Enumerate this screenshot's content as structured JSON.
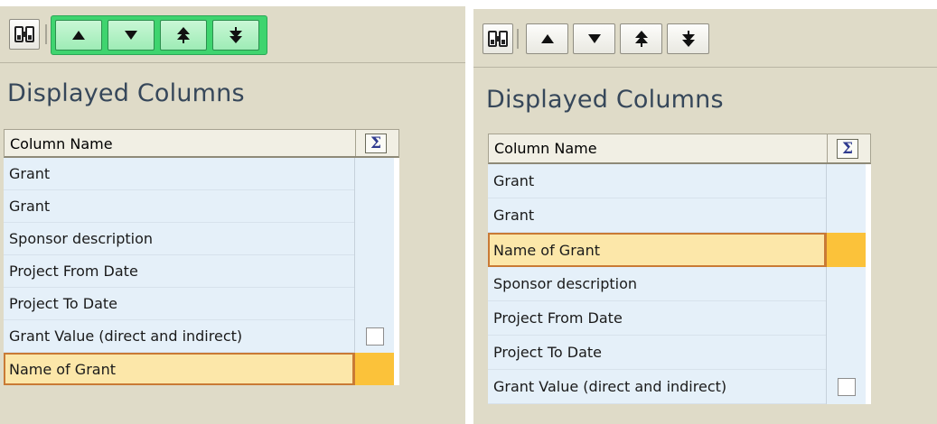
{
  "panels": [
    {
      "toolbar": {
        "find_icon": "binoculars-icon",
        "move_buttons": [
          {
            "icon": "arrow-up-icon",
            "glyph": "▲"
          },
          {
            "icon": "arrow-down-icon",
            "glyph": "▼"
          },
          {
            "icon": "arrow-top-icon",
            "glyph": "⯭"
          },
          {
            "icon": "arrow-bottom-icon",
            "glyph": "⯯"
          }
        ],
        "move_group_highlighted": true
      },
      "title": "Displayed Columns",
      "table": {
        "header_name": "Column Name",
        "header_sum_icon": "sigma-icon",
        "header_sum_glyph": "Σ",
        "rows": [
          {
            "name": "Grant",
            "selected": false,
            "checkbox": false
          },
          {
            "name": "Grant",
            "selected": false,
            "checkbox": false
          },
          {
            "name": "Sponsor description",
            "selected": false,
            "checkbox": false
          },
          {
            "name": "Project From Date",
            "selected": false,
            "checkbox": false
          },
          {
            "name": "Project To Date",
            "selected": false,
            "checkbox": false
          },
          {
            "name": "Grant Value (direct and indirect)",
            "selected": false,
            "checkbox": true
          },
          {
            "name": "Name of Grant",
            "selected": true,
            "checkbox": false
          }
        ]
      }
    },
    {
      "toolbar": {
        "find_icon": "binoculars-icon",
        "move_buttons": [
          {
            "icon": "arrow-up-icon",
            "glyph": "▲"
          },
          {
            "icon": "arrow-down-icon",
            "glyph": "▼"
          },
          {
            "icon": "arrow-top-icon",
            "glyph": "⯭"
          },
          {
            "icon": "arrow-bottom-icon",
            "glyph": "⯯"
          }
        ],
        "move_group_highlighted": false
      },
      "title": "Displayed Columns",
      "table": {
        "header_name": "Column Name",
        "header_sum_icon": "sigma-icon",
        "header_sum_glyph": "Σ",
        "rows": [
          {
            "name": "Grant",
            "selected": false,
            "checkbox": false
          },
          {
            "name": "Grant",
            "selected": false,
            "checkbox": false
          },
          {
            "name": "Name of Grant",
            "selected": true,
            "checkbox": false
          },
          {
            "name": "Sponsor description",
            "selected": false,
            "checkbox": false
          },
          {
            "name": "Project From Date",
            "selected": false,
            "checkbox": false
          },
          {
            "name": "Project To Date",
            "selected": false,
            "checkbox": false
          },
          {
            "name": "Grant Value (direct and indirect)",
            "selected": false,
            "checkbox": true
          }
        ]
      }
    }
  ],
  "colors": {
    "panel_bg": "#dfdbc8",
    "title_text": "#36475a",
    "row_bg": "#e5f0f9",
    "selected_row_bg": "#fce7a9",
    "selected_row_border": "#c97a35",
    "selected_sum_bg": "#fbc23a",
    "highlight_group_bg": "#3fd46f"
  }
}
